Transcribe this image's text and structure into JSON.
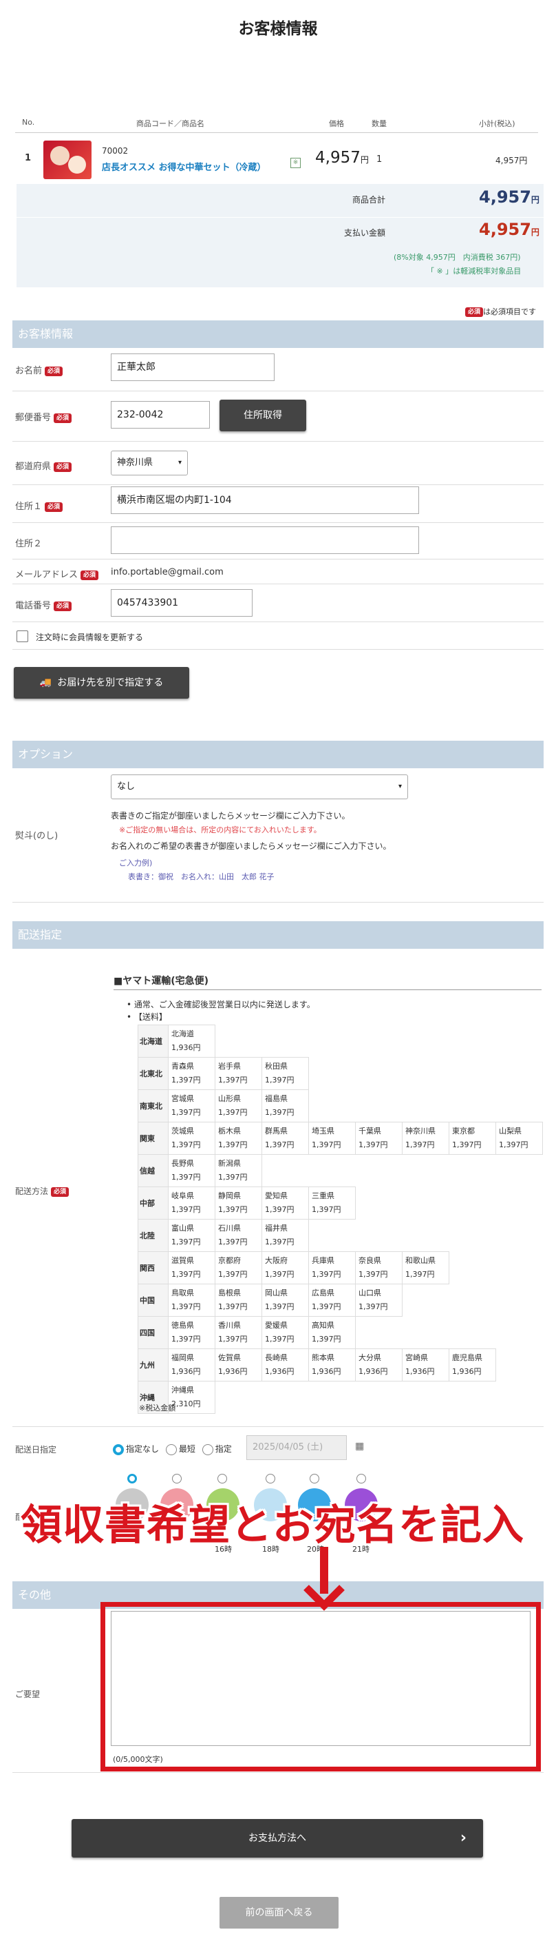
{
  "page_title": "お客様情報",
  "cart": {
    "headers": {
      "no": "No.",
      "code_name": "商品コード／商品名",
      "price": "価格",
      "qty": "数量",
      "subtotal": "小計(税込)"
    },
    "item": {
      "no": "1",
      "code": "70002",
      "name": "店長オススメ お得な中華セット（冷蔵）",
      "mark": "※",
      "price": "4,957",
      "price_unit": "円",
      "qty": "1",
      "subtotal": "4,957円"
    },
    "total_label": "商品合計",
    "total_value": "4,957",
    "total_unit": "円",
    "pay_label": "支払い金額",
    "pay_value": "4,957",
    "pay_unit": "円",
    "tax_note": "(8%対象 4,957円　内消費税 367円)",
    "reduced_note": "「 ※ 」は軽減税率対象品目"
  },
  "required_badge": "必須",
  "required_note": "は必須項目です",
  "customer": {
    "heading": "お客様情報",
    "name_label": "お名前",
    "name_value": "正華太郎",
    "zip_label": "郵便番号",
    "zip_value": "232-0042",
    "zip_button": "住所取得",
    "pref_label": "都道府県",
    "pref_value": "神奈川県",
    "addr1_label": "住所１",
    "addr1_value": "横浜市南区堀の内町1-104",
    "addr2_label": "住所２",
    "addr2_value": "",
    "email_label": "メールアドレス",
    "email_value": "info.portable@gmail.com",
    "tel_label": "電話番号",
    "tel_value": "0457433901",
    "update_label": "注文時に会員情報を更新する",
    "ship_other_button": "お届け先を別で指定する"
  },
  "options": {
    "heading": "オプション",
    "noshi_label": "熨斗(のし)",
    "noshi_value": "なし",
    "msg1": "表書きのご指定が御座いましたらメッセージ欄にご入力下さい。",
    "msg2": "※ご指定の無い場合は、所定の内容にてお入れいたします。",
    "msg3": "お名入れのご希望の表書きが御座いましたらメッセージ欄にご入力下さい。",
    "example_title": "ご入力例)",
    "example_body": "表書き：御祝　お名入れ：山田　太郎 花子"
  },
  "delivery": {
    "heading": "配送指定",
    "method_label": "配送方法",
    "carrier": "■ヤマト運輸(宅急便)",
    "bullet1": "通常、ご入金確認後翌営業日以内に発送します。",
    "bullet2": "【送料】",
    "regions": [
      {
        "name": "北海道",
        "prefs": [
          [
            "北海道",
            "1,936円"
          ]
        ]
      },
      {
        "name": "北東北",
        "prefs": [
          [
            "青森県",
            "1,397円"
          ],
          [
            "岩手県",
            "1,397円"
          ],
          [
            "秋田県",
            "1,397円"
          ]
        ]
      },
      {
        "name": "南東北",
        "prefs": [
          [
            "宮城県",
            "1,397円"
          ],
          [
            "山形県",
            "1,397円"
          ],
          [
            "福島県",
            "1,397円"
          ]
        ]
      },
      {
        "name": "関東",
        "prefs": [
          [
            "茨城県",
            "1,397円"
          ],
          [
            "栃木県",
            "1,397円"
          ],
          [
            "群馬県",
            "1,397円"
          ],
          [
            "埼玉県",
            "1,397円"
          ],
          [
            "千葉県",
            "1,397円"
          ],
          [
            "神奈川県",
            "1,397円"
          ],
          [
            "東京都",
            "1,397円"
          ],
          [
            "山梨県",
            "1,397円"
          ]
        ]
      },
      {
        "name": "信越",
        "prefs": [
          [
            "長野県",
            "1,397円"
          ],
          [
            "新潟県",
            "1,397円"
          ]
        ]
      },
      {
        "name": "中部",
        "prefs": [
          [
            "岐阜県",
            "1,397円"
          ],
          [
            "静岡県",
            "1,397円"
          ],
          [
            "愛知県",
            "1,397円"
          ],
          [
            "三重県",
            "1,397円"
          ]
        ]
      },
      {
        "name": "北陸",
        "prefs": [
          [
            "富山県",
            "1,397円"
          ],
          [
            "石川県",
            "1,397円"
          ],
          [
            "福井県",
            "1,397円"
          ]
        ]
      },
      {
        "name": "関西",
        "prefs": [
          [
            "滋賀県",
            "1,397円"
          ],
          [
            "京都府",
            "1,397円"
          ],
          [
            "大阪府",
            "1,397円"
          ],
          [
            "兵庫県",
            "1,397円"
          ],
          [
            "奈良県",
            "1,397円"
          ],
          [
            "和歌山県",
            "1,397円"
          ]
        ]
      },
      {
        "name": "中国",
        "prefs": [
          [
            "鳥取県",
            "1,397円"
          ],
          [
            "島根県",
            "1,397円"
          ],
          [
            "岡山県",
            "1,397円"
          ],
          [
            "広島県",
            "1,397円"
          ],
          [
            "山口県",
            "1,397円"
          ]
        ]
      },
      {
        "name": "四国",
        "prefs": [
          [
            "徳島県",
            "1,397円"
          ],
          [
            "香川県",
            "1,397円"
          ],
          [
            "愛媛県",
            "1,397円"
          ],
          [
            "高知県",
            "1,397円"
          ]
        ]
      },
      {
        "name": "九州",
        "prefs": [
          [
            "福岡県",
            "1,936円"
          ],
          [
            "佐賀県",
            "1,936円"
          ],
          [
            "長崎県",
            "1,936円"
          ],
          [
            "熊本県",
            "1,936円"
          ],
          [
            "大分県",
            "1,936円"
          ],
          [
            "宮崎県",
            "1,936円"
          ],
          [
            "鹿児島県",
            "1,936円"
          ]
        ]
      },
      {
        "name": "沖縄",
        "prefs": [
          [
            "沖縄県",
            "2,310円"
          ]
        ]
      }
    ],
    "tax_note": "※税込金額",
    "date_label": "配送日指定",
    "date_opt_none": "指定なし",
    "date_opt_earliest": "最短",
    "date_opt_specify": "指定",
    "date_value": "2025/04/05 (土)",
    "time_label": "配送",
    "time_slots": [
      "16時",
      "18時",
      "20時",
      "21時"
    ]
  },
  "overlay_text": "領収書希望とお宛名を記入",
  "other": {
    "heading": "その他",
    "request_label": "ご要望",
    "char_count": "(0/5,000文字)"
  },
  "buttons": {
    "to_payment": "お支払方法へ",
    "back": "前の画面へ戻る"
  }
}
